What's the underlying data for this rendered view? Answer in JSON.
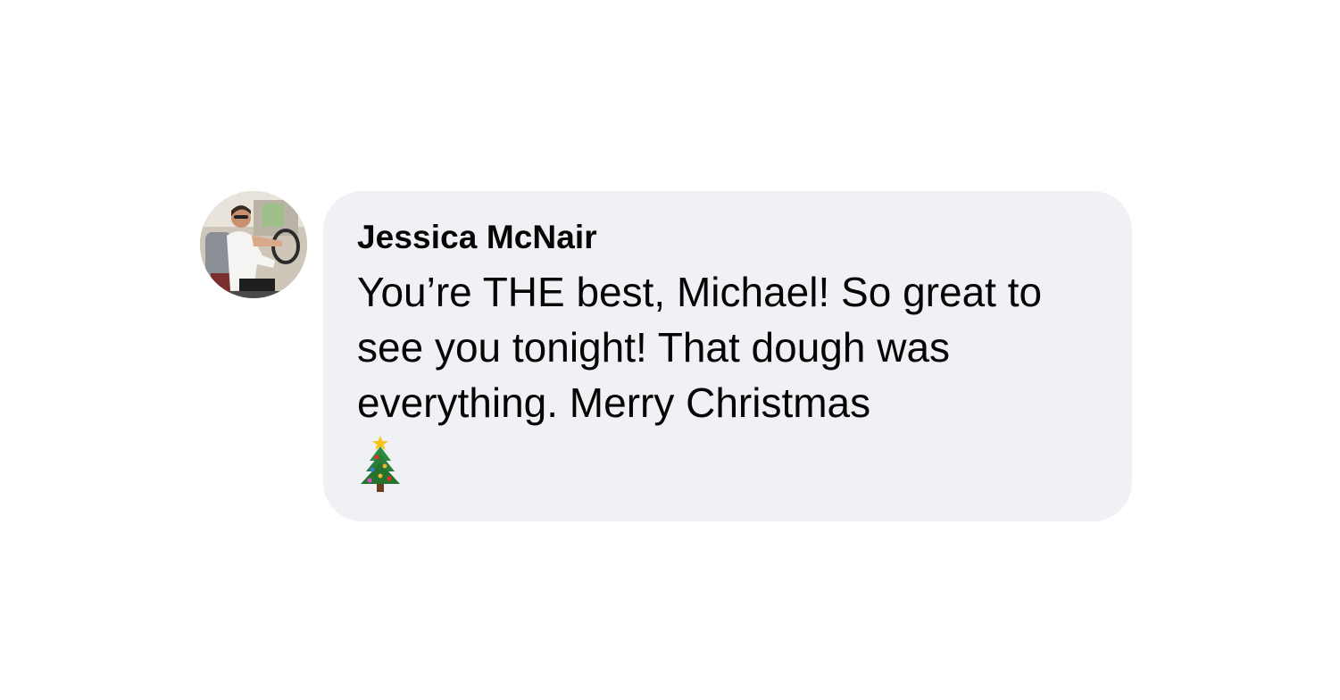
{
  "comment": {
    "author": "Jessica McNair",
    "message": "You’re THE best, Michael! So great to see you tonight! That dough was everything. Merry Christmas",
    "emoji": "christmas-tree-icon",
    "avatar": "profile-photo"
  },
  "colors": {
    "bubble": "#f0f1f4",
    "text": "#050505",
    "background": "#ffffff"
  }
}
